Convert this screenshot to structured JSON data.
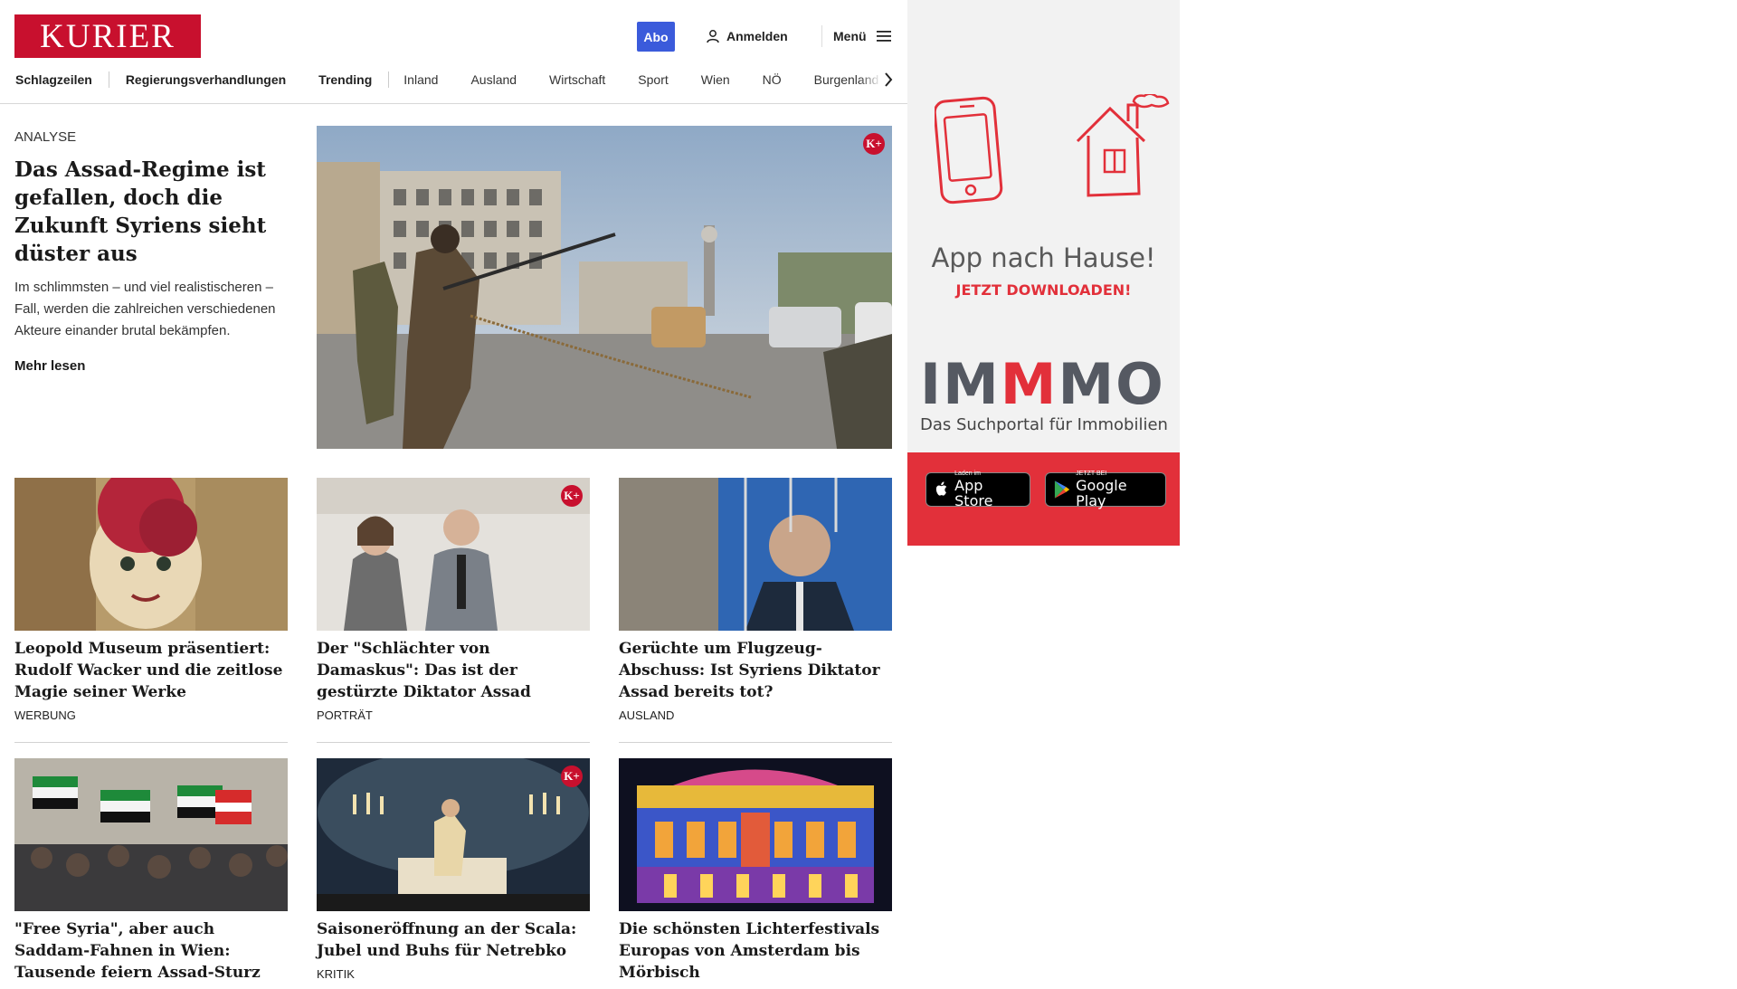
{
  "header": {
    "logo": "KURIER",
    "abo_label": "Abo",
    "login_label": "Anmelden",
    "menu_label": "Menü"
  },
  "nav": {
    "items": [
      "Schlagzeilen",
      "Regierungsverhandlungen",
      "Trending",
      "Inland",
      "Ausland",
      "Wirtschaft",
      "Sport",
      "Wien",
      "NÖ",
      "Burgenland"
    ]
  },
  "lead": {
    "kicker": "ANALYSE",
    "headline": "Das Assad-Regime ist ge­fallen, doch die Zukunft Syriens sieht düster aus",
    "teaser": "Im schlimmsten – und viel realistischeren – Fall, werden die zahlreichen verschiedenen Akteure einander brutal bekämpfen.",
    "more": "Mehr lesen",
    "premium_badge": "K+"
  },
  "cards": [
    {
      "title": "Leopold Museum präsentiert: Ru­dolf Wacker und die zeitlose Magie seiner Werke",
      "category": "WERBUNG",
      "premium": false
    },
    {
      "title": "Der \"Schlächter von Damaskus\": Das ist der gestürzte Diktator Assad",
      "category": "PORTRÄT",
      "premium": true
    },
    {
      "title": "Gerüchte um Flugzeug-Abschuss: Ist Syriens Diktator Assad bereits tot?",
      "category": "AUSLAND",
      "premium": false
    },
    {
      "title": "\"Free Syria\", aber auch Saddam-Fahnen in Wien: Tausende feiern Assad-Sturz",
      "category": "",
      "premium": false
    },
    {
      "title": "Saisoneröffnung an der Scala: Ju­bel und Buhs für Netrebko",
      "category": "KRITIK",
      "premium": true
    },
    {
      "title": "Die schönsten Lichterfestivals Eu­ropas von Amsterdam bis Mörbisch",
      "category": "",
      "premium": false
    }
  ],
  "ad": {
    "title": "App nach Hause!",
    "subtitle": "JETZT DOWNLOADEN!",
    "brand_left": "IM",
    "brand_mid": "M",
    "brand_right": "MO",
    "tagline": "Das Suchportal für Immobilien",
    "appstore_small": "Laden im",
    "appstore_big": "App Store",
    "googleplay_small": "JETZT BEI",
    "googleplay_big": "Google Play"
  },
  "colors": {
    "brand_red": "#c8102e",
    "abo_blue": "#3b5bdb",
    "ad_red": "#e2303a"
  }
}
